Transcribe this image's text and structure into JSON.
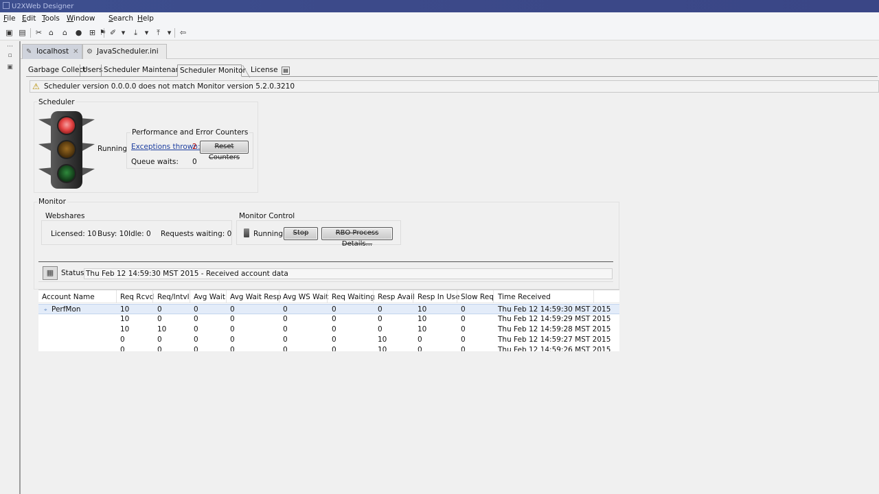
{
  "window": {
    "title": "U2XWeb Designer"
  },
  "menu": [
    "File",
    "Edit",
    "Tools",
    "Window",
    "Search",
    "Help"
  ],
  "editor_tabs": [
    {
      "label": "localhost",
      "active": true,
      "close": "✕"
    },
    {
      "label": "JavaScheduler.ini",
      "active": false
    }
  ],
  "panel_tabs": [
    "Garbage Collect",
    "Users",
    "Scheduler Maintenance",
    "Scheduler Monitor",
    "License"
  ],
  "active_panel_tab": "Scheduler Monitor",
  "warning": "Scheduler version  0.0.0.0 does not match Monitor version 5.2.0.3210",
  "scheduler": {
    "group_title": "Scheduler",
    "state": "Running",
    "counters_title": "Performance and Error Counters",
    "exceptions_label": "Exceptions thrown:",
    "exceptions_value": "2",
    "reset_button": "Reset Counters",
    "queue_waits_label": "Queue waits:",
    "queue_waits_value": "0"
  },
  "monitor": {
    "group_title": "Monitor",
    "webshares_title": "Webshares",
    "licensed_label": "Licensed: 10",
    "busy_label": "Busy: 10",
    "idle_label": "Idle: 0",
    "requests_waiting_label": "Requests waiting: 0",
    "control_title": "Monitor Control",
    "control_state": "Running",
    "stop_button": "Stop",
    "details_button": "RBO Process Details...",
    "status_label": "Status:",
    "status_value": "Thu Feb 12 14:59:30 MST 2015 - Received account data"
  },
  "table": {
    "columns": [
      "Account Name",
      "Req Rcvd",
      "Req/Intvl",
      "Avg Wait",
      "Avg Wait Resp",
      "Avg WS Wait",
      "Req Waiting",
      "Resp Avail",
      "Resp In Use",
      "Slow Req",
      "Time Received"
    ],
    "rows": [
      [
        "PerfMon",
        "10",
        "0",
        "0",
        "0",
        "0",
        "0",
        "0",
        "10",
        "0",
        "Thu Feb 12 14:59:30 MST 2015"
      ],
      [
        "",
        "10",
        "0",
        "0",
        "0",
        "0",
        "0",
        "0",
        "10",
        "0",
        "Thu Feb 12 14:59:29 MST 2015"
      ],
      [
        "",
        "10",
        "10",
        "0",
        "0",
        "0",
        "0",
        "0",
        "10",
        "0",
        "Thu Feb 12 14:59:28 MST 2015"
      ],
      [
        "",
        "0",
        "0",
        "0",
        "0",
        "0",
        "0",
        "10",
        "0",
        "0",
        "Thu Feb 12 14:59:27 MST 2015"
      ],
      [
        "",
        "0",
        "0",
        "0",
        "0",
        "0",
        "0",
        "10",
        "0",
        "0",
        "Thu Feb 12 14:59:26 MST 2015"
      ]
    ]
  },
  "colors": {
    "titlebar": "#3d4f8f",
    "link": "#1d3e9f",
    "selected_row": "#e3ecf9",
    "warn": "#b58d00"
  }
}
